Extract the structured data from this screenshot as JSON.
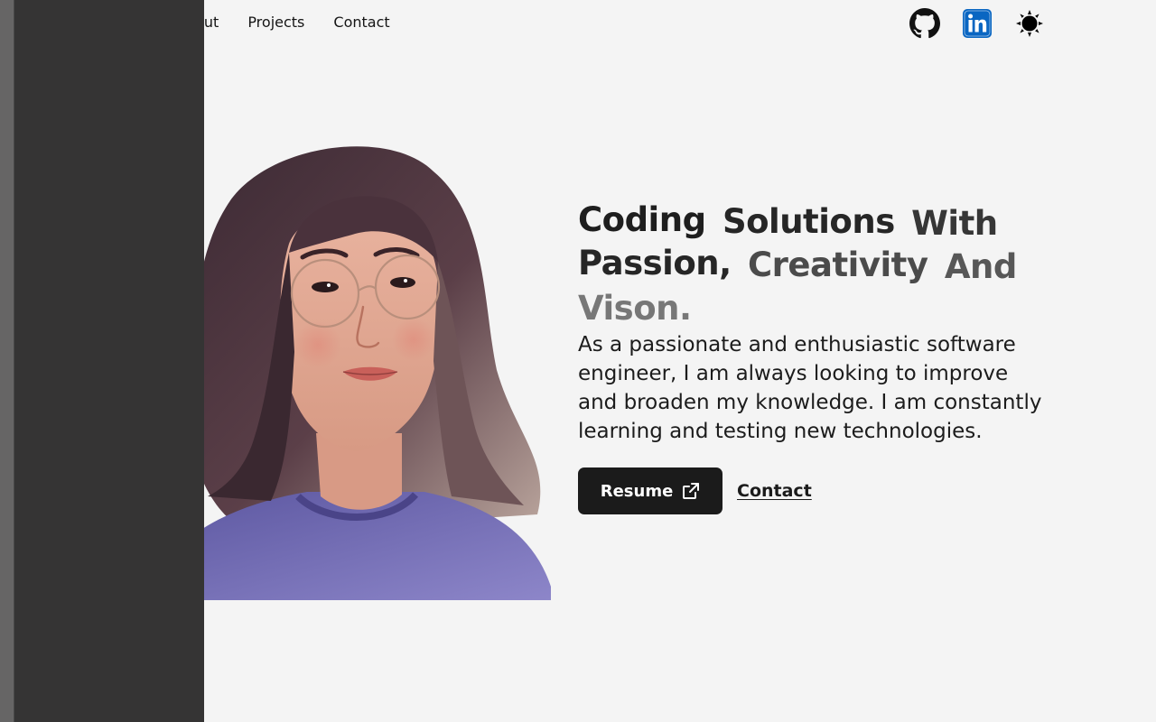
{
  "nav": {
    "links": [
      "About",
      "Projects",
      "Contact"
    ],
    "icons": [
      "github-icon",
      "linkedin-icon",
      "sun-icon"
    ]
  },
  "hero": {
    "headline_words": [
      "Coding",
      "Solutions",
      "With",
      "Passion,",
      "Creativity",
      "And",
      "Vison."
    ],
    "intro": "As a passionate and enthusiastic software engineer, I am always looking to improve and broaden my knowledge. I am constantly learning and testing new technologies.",
    "resume_label": "Resume",
    "contact_label": "Contact"
  },
  "colors": {
    "background": "#f4f4f4",
    "drawer": "#353434",
    "drawer_rail": "#666565",
    "button_dark": "#1b1b1b",
    "linkedin_blue": "#0a66c2"
  }
}
